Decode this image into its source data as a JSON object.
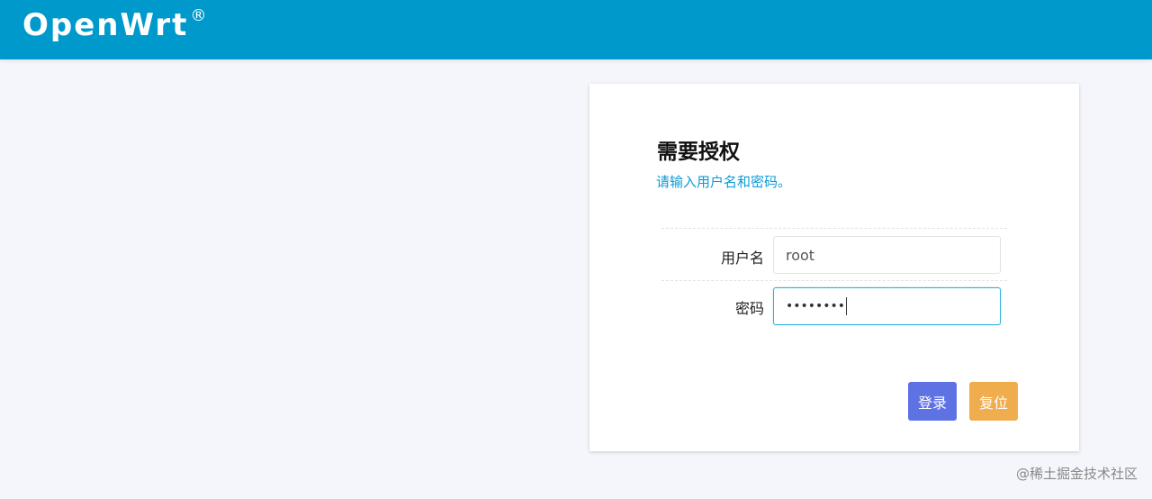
{
  "header": {
    "brand": "OpenWrt",
    "brand_mark": "®",
    "color": "#0099cc"
  },
  "login": {
    "title": "需要授权",
    "subtitle": "请输入用户名和密码。",
    "username_label": "用户名",
    "username_value": "root",
    "password_label": "密码",
    "password_value": "••••••••",
    "login_button": "登录",
    "reset_button": "复位",
    "colors": {
      "subtitle": "#0a9bd8",
      "login_button": "#5e72e4",
      "reset_button": "#f0ad4e",
      "focus_border": "#30b0e0"
    }
  },
  "watermark": "@稀土掘金技术社区"
}
